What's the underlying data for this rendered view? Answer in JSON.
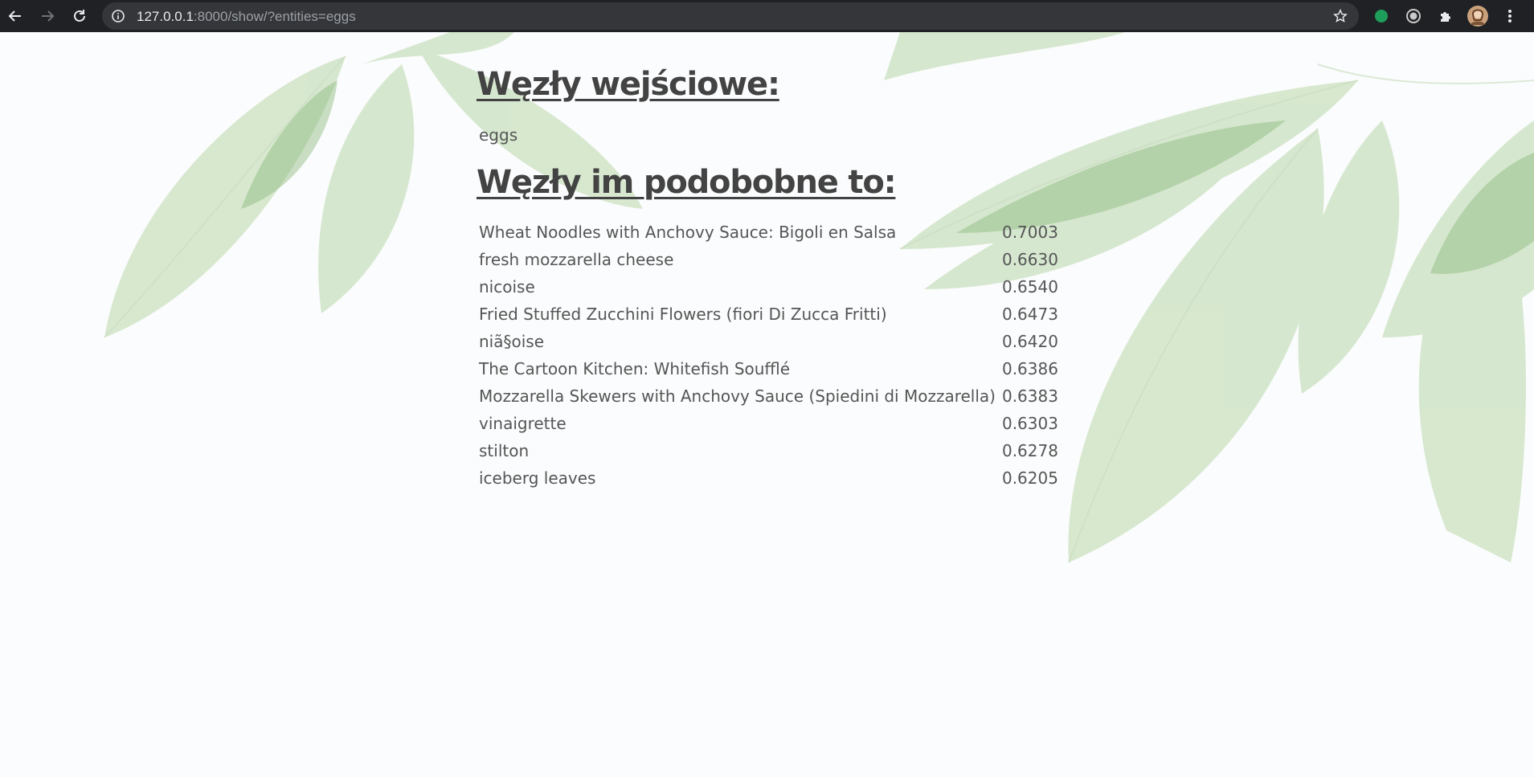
{
  "browser": {
    "url_host": "127.0.0.1",
    "url_rest": ":8000/show/?entities=eggs"
  },
  "page": {
    "input_heading": "Węzły wejściowe:",
    "input_nodes": [
      "eggs"
    ],
    "similar_heading": "Węzły im podobobne to:",
    "similar_nodes": [
      {
        "name": "Wheat Noodles with Anchovy Sauce: Bigoli en Salsa",
        "score": "0.7003"
      },
      {
        "name": "fresh mozzarella cheese",
        "score": "0.6630"
      },
      {
        "name": "nicoise",
        "score": "0.6540"
      },
      {
        "name": "Fried Stuffed Zucchini Flowers (fiori Di Zucca Fritti)",
        "score": "0.6473"
      },
      {
        "name": "niã§oise",
        "score": "0.6420"
      },
      {
        "name": "The Cartoon Kitchen: Whitefish Soufflé",
        "score": "0.6386"
      },
      {
        "name": "Mozzarella Skewers with Anchovy Sauce (Spiedini di Mozzarella)",
        "score": "0.6383"
      },
      {
        "name": "vinaigrette",
        "score": "0.6303"
      },
      {
        "name": "stilton",
        "score": "0.6278"
      },
      {
        "name": "iceberg leaves",
        "score": "0.6205"
      }
    ]
  },
  "colors": {
    "chrome": "#202124",
    "omnibox": "#35363a",
    "text": "#555555",
    "leaf": "#9cc48c"
  }
}
